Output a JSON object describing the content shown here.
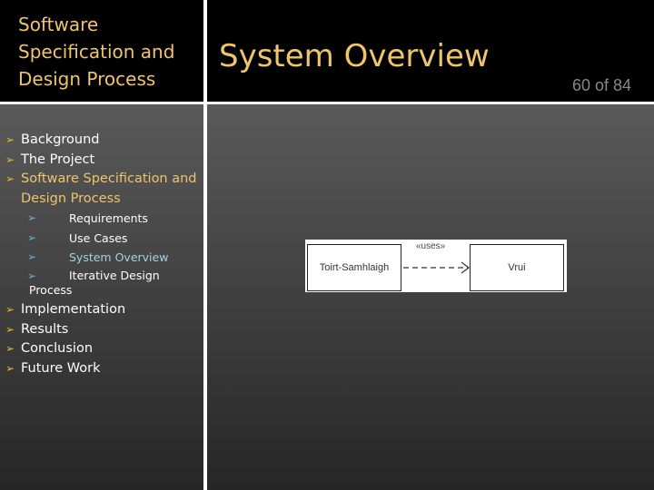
{
  "sidebar": {
    "title": "Software Specification and Design Process",
    "items": [
      {
        "label": "Background"
      },
      {
        "label": "The Project"
      },
      {
        "label": "Software Specification and Design Process"
      }
    ],
    "subitems": [
      {
        "label": "Requirements"
      },
      {
        "label": "Use Cases"
      },
      {
        "label": "System Overview"
      },
      {
        "label": "Iterative Design"
      }
    ],
    "subitem_continuation": "Process",
    "items2": [
      {
        "label": "Implementation"
      },
      {
        "label": "Results"
      },
      {
        "label": "Conclusion"
      },
      {
        "label": "Future Work"
      }
    ]
  },
  "slide": {
    "title": "System Overview",
    "page": "60 of 84"
  },
  "diagram": {
    "left": "Toirt-Samhlaigh",
    "right": "Vrui",
    "relation": "«uses»"
  },
  "colors": {
    "accent": "#f0c46a",
    "bullet": "#f0b830",
    "current": "#a8d0e0"
  }
}
